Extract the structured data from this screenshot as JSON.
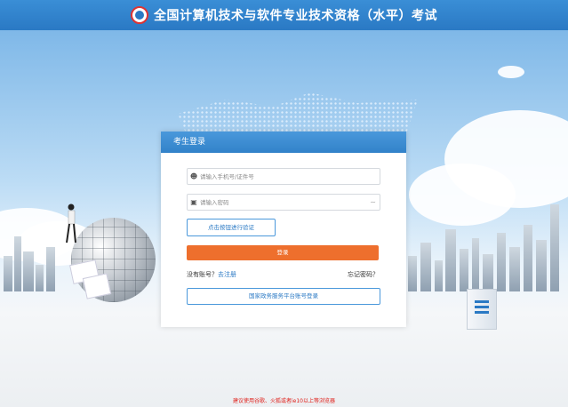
{
  "header": {
    "title": "全国计算机技术与软件专业技术资格（水平）考试",
    "logo_icon": "exam-logo-icon"
  },
  "login": {
    "panel_title": "考生登录",
    "account_placeholder": "请输入手机号/证件号",
    "password_placeholder": "请输入密码",
    "verify_button": "点击按钮进行验证",
    "login_button": "登录",
    "no_account_text": "没有账号？",
    "register_link": "去注册",
    "forgot_password": "忘记密码？",
    "gov_login_button": "国家政务服务平台账号登录"
  },
  "footer": {
    "browser_note": "建议使用谷歌、火狐或者ie10以上等浏览器"
  },
  "colors": {
    "header_blue": "#2a79c4",
    "login_orange": "#ee6f2d",
    "note_red": "#e0201a"
  }
}
